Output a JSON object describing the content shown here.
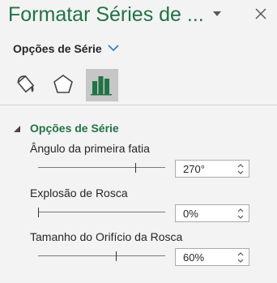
{
  "panel": {
    "title": "Formatar Séries de ...",
    "series_options_label": "Opções de Série"
  },
  "tabs": [
    {
      "name": "fill-line",
      "icon": "paint-bucket-icon",
      "active": false
    },
    {
      "name": "effects",
      "icon": "pentagon-icon",
      "active": false
    },
    {
      "name": "series-options",
      "icon": "bar-chart-icon",
      "active": true
    }
  ],
  "section": {
    "title": "Opções de Série",
    "options": [
      {
        "label": "Ângulo da primeira fatia",
        "value": "270°",
        "level": 0.75
      },
      {
        "label": "Explosão de Rosca",
        "value": "0%",
        "level": 0.0
      },
      {
        "label": "Tamanho do Orifício da Rosca",
        "value": "60%",
        "level": 0.6
      }
    ]
  },
  "colors": {
    "accent": "#217346",
    "background": "#f3f3f3",
    "active_tab": "#c6c6c6"
  }
}
